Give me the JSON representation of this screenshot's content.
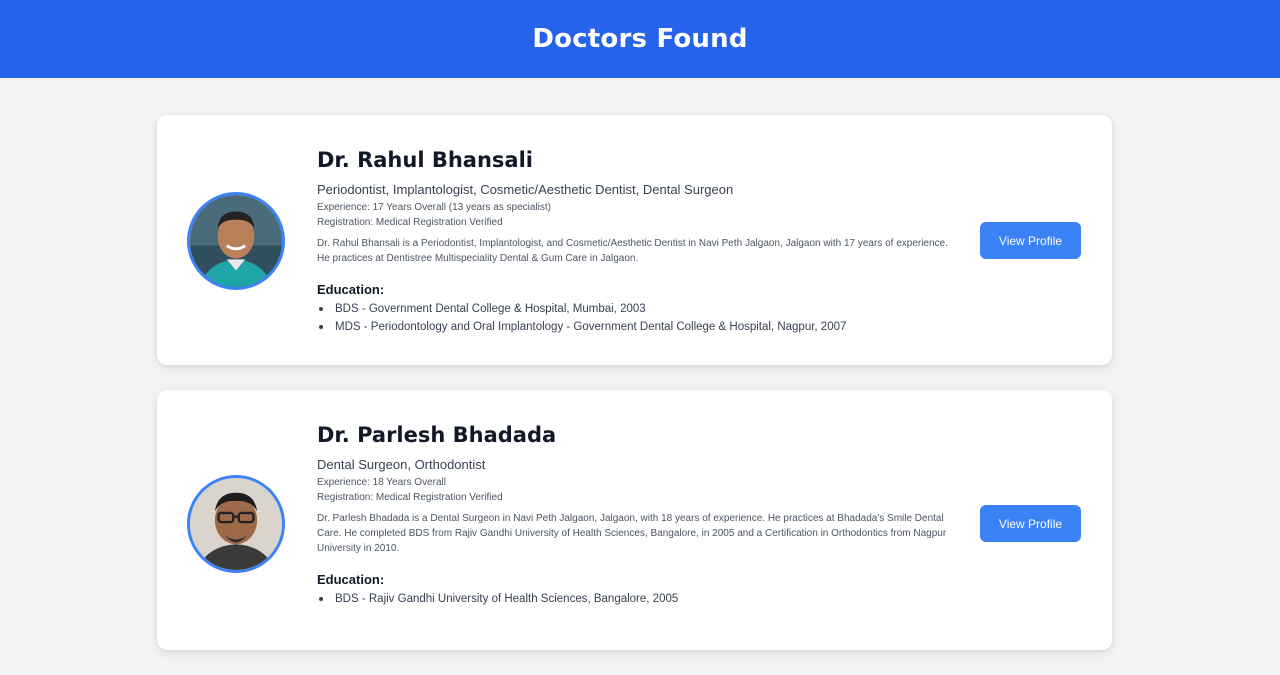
{
  "header": {
    "title": "Doctors Found"
  },
  "doctors": [
    {
      "name": "Dr. Rahul Bhansali",
      "specialties": "Periodontist, Implantologist, Cosmetic/Aesthetic Dentist, Dental Surgeon",
      "experience": "Experience: 17 Years Overall (13 years as specialist)",
      "registration": "Registration: Medical Registration Verified",
      "description": "Dr. Rahul Bhansali is a Periodontist, Implantologist, and Cosmetic/Aesthetic Dentist in Navi Peth Jalgaon, Jalgaon with 17 years of experience. He practices at Dentistree Multispeciality Dental & Gum Care in Jalgaon.",
      "education_heading": "Education:",
      "education": [
        "BDS - Government Dental College & Hospital, Mumbai, 2003",
        "MDS - Periodontology and Oral Implantology - Government Dental College & Hospital, Nagpur, 2007"
      ],
      "button_label": "View Profile"
    },
    {
      "name": "Dr. Parlesh Bhadada",
      "specialties": "Dental Surgeon, Orthodontist",
      "experience": "Experience: 18 Years Overall",
      "registration": "Registration: Medical Registration Verified",
      "description": "Dr. Parlesh Bhadada is a Dental Surgeon in Navi Peth Jalgaon, Jalgaon, with 18 years of experience. He practices at Bhadada's Smile Dental Care. He completed BDS from Rajiv Gandhi University of Health Sciences, Bangalore, in 2005 and a Certification in Orthodontics from Nagpur University in 2010.",
      "education_heading": "Education:",
      "education": [
        "BDS - Rajiv Gandhi University of Health Sciences, Bangalore, 2005"
      ],
      "button_label": "View Profile"
    }
  ],
  "colors": {
    "header_bg": "#2563eb",
    "accent": "#3b82f6",
    "page_bg": "#f2f3f5",
    "card_bg": "#ffffff"
  }
}
